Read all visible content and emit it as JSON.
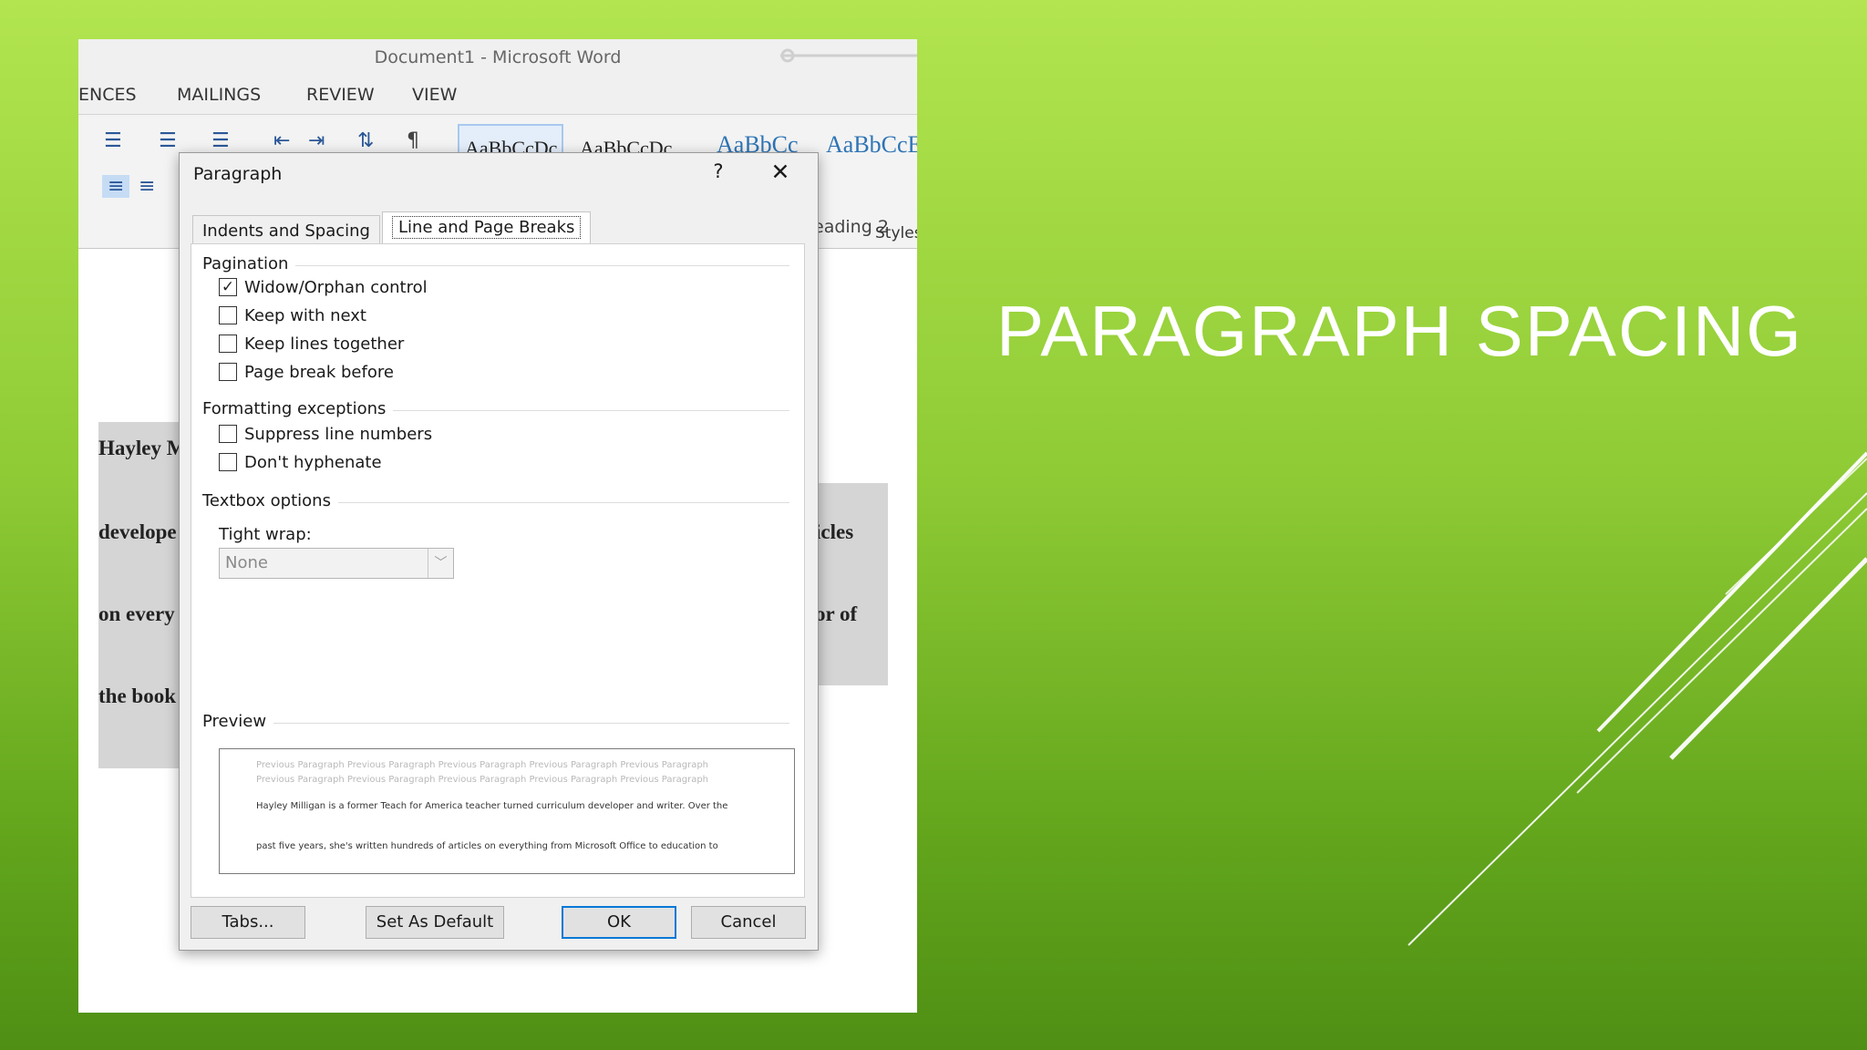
{
  "slide": {
    "title": "PARAGRAPH SPACING"
  },
  "word": {
    "window_title": "Document1 - Microsoft Word",
    "ribbon_tabs": [
      "ENCES",
      "MAILINGS",
      "REVIEW",
      "VIEW"
    ],
    "style_gallery": [
      "AaBbCcDc",
      "AaBbCcDc",
      "AaBbCc",
      "AaBbCcE"
    ],
    "heading_label": "eading 2",
    "styles_group_label": "Styles",
    "doc_left_words": [
      "Hayley M",
      "develope",
      "on every",
      "the book"
    ],
    "doc_right_words": [
      "icles",
      "or of"
    ]
  },
  "dialog": {
    "title": "Paragraph",
    "help_glyph": "?",
    "close_glyph": "✕",
    "tabs": {
      "indents": "Indents and Spacing",
      "line_breaks": "Line and Page Breaks"
    },
    "pagination": {
      "label": "Pagination",
      "widow_orphan": {
        "label": "Widow/Orphan control",
        "checked": true
      },
      "keep_with_next": {
        "label": "Keep with next",
        "checked": false
      },
      "keep_lines_together": {
        "label": "Keep lines together",
        "checked": false
      },
      "page_break_before": {
        "label": "Page break before",
        "checked": false
      }
    },
    "formatting": {
      "label": "Formatting exceptions",
      "suppress_line_numbers": {
        "label": "Suppress line numbers",
        "checked": false
      },
      "dont_hyphenate": {
        "label": "Don't hyphenate",
        "checked": false
      }
    },
    "textbox": {
      "label": "Textbox options",
      "tight_wrap_label": "Tight wrap:",
      "tight_wrap_value": "None"
    },
    "preview": {
      "label": "Preview",
      "previous_line_1": "Previous Paragraph Previous Paragraph Previous Paragraph Previous Paragraph Previous Paragraph",
      "previous_line_2": "Previous Paragraph Previous Paragraph Previous Paragraph Previous Paragraph Previous Paragraph",
      "current_line_1": "Hayley Milligan is a former Teach for America teacher turned curriculum developer and writer. Over the",
      "current_line_2": "past five years, she's written hundreds of articles on everything from Microsoft Office to education to"
    },
    "buttons": {
      "tabs": "Tabs...",
      "set_default": "Set As Default",
      "ok": "OK",
      "cancel": "Cancel"
    }
  }
}
